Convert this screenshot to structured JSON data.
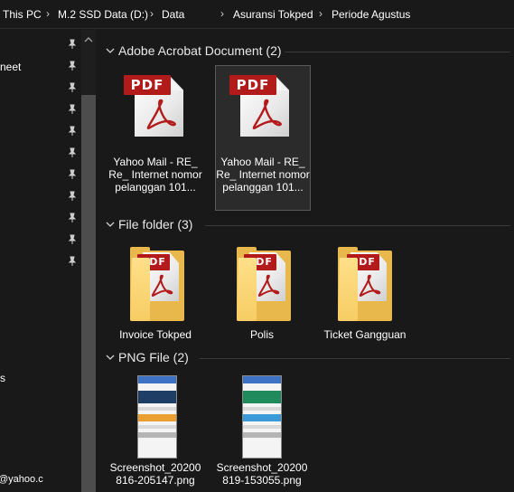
{
  "breadcrumb": {
    "items": [
      "This PC",
      "M.2 SSD Data (D:)",
      "Data",
      "Asuransi Tokped",
      "Periode Agustus"
    ]
  },
  "nav": {
    "fragments": [
      "neet",
      "s",
      "@yahoo.c"
    ],
    "pin_icon": "pin-icon"
  },
  "groups": [
    {
      "title": "Adobe Acrobat Document (2)",
      "items": [
        {
          "label": "Yahoo Mail - RE_ Re_ Internet nomor pelanggan 101...",
          "icon": "pdf-file-icon",
          "badge": "PDF"
        },
        {
          "label": "Yahoo Mail - RE_ Re_ Internet nomor pelanggan 101...",
          "icon": "pdf-file-icon",
          "badge": "PDF",
          "selected": true
        }
      ]
    },
    {
      "title": "File folder (3)",
      "items": [
        {
          "label": "Invoice Tokped",
          "icon": "folder-icon",
          "badge": "PDF"
        },
        {
          "label": "Polis",
          "icon": "folder-icon",
          "badge": "PDF"
        },
        {
          "label": "Ticket Gangguan",
          "icon": "folder-icon",
          "badge": "PDF"
        }
      ]
    },
    {
      "title": "PNG File (2)",
      "items": [
        {
          "label": "Screenshot_20200816-205147.png",
          "icon": "png-thumbnail"
        },
        {
          "label": "Screenshot_20200819-153055.png",
          "icon": "png-thumbnail"
        }
      ]
    }
  ],
  "colors": {
    "background": "#191919",
    "pdf_red": "#b31b1b",
    "folder_yellow": "#f7cc64",
    "selection": "#2b2b2b"
  }
}
